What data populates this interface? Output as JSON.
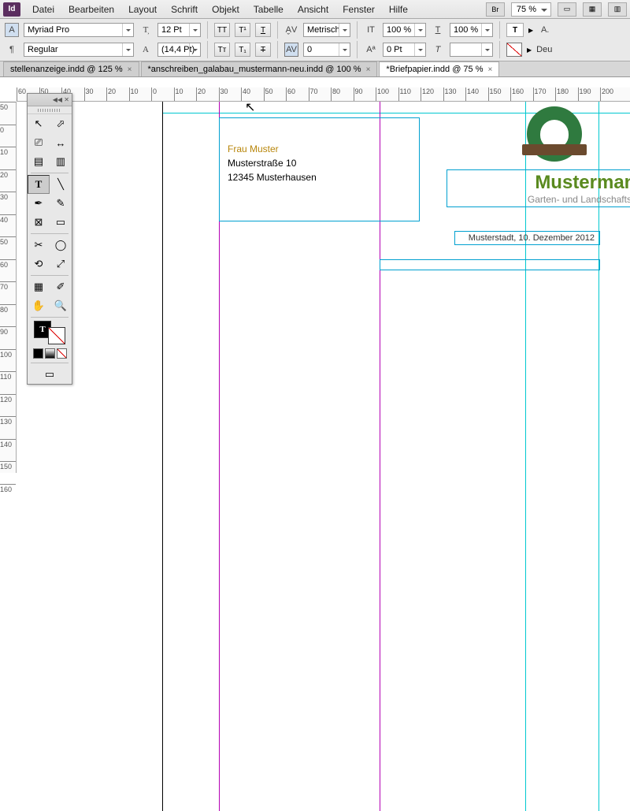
{
  "app": {
    "name": "Id"
  },
  "menu": [
    "Datei",
    "Bearbeiten",
    "Layout",
    "Schrift",
    "Objekt",
    "Tabelle",
    "Ansicht",
    "Fenster",
    "Hilfe"
  ],
  "zoom": "75 %",
  "br_label": "Br",
  "control": {
    "font": "Myriad Pro",
    "style": "Regular",
    "size": "12 Pt",
    "leading": "(14,4 Pt)",
    "kerning_mode": "Metrisch",
    "tracking": "0",
    "hscale": "100 %",
    "vscale": "100 %",
    "baseline": "0 Pt",
    "lang": "Deu"
  },
  "tabs": [
    {
      "label": "stellenanzeige.indd @ 125 %",
      "active": false
    },
    {
      "label": "*anschreiben_galabau_mustermann-neu.indd @ 100 %",
      "active": false
    },
    {
      "label": "*Briefpapier.indd @ 75 %",
      "active": true
    }
  ],
  "ruler_h": [
    "60",
    "50",
    "40",
    "30",
    "20",
    "10",
    "0",
    "10",
    "20",
    "30",
    "40",
    "50",
    "60",
    "70",
    "80",
    "90",
    "100",
    "110",
    "120",
    "130",
    "140",
    "150",
    "160",
    "170",
    "180",
    "190",
    "200"
  ],
  "ruler_v": [
    "50",
    "0",
    "10",
    "20",
    "30",
    "40",
    "50",
    "60",
    "70",
    "80",
    "90",
    "100",
    "110",
    "120",
    "130",
    "140",
    "150",
    "160"
  ],
  "doc": {
    "address": {
      "salutation": "Frau Muster",
      "street": "Musterstraße 10",
      "city": "12345 Musterhausen"
    },
    "company": {
      "name": "Mustermann",
      "sub": "Garten- und Landschaftsbau"
    },
    "date": "Musterstadt, 10. Dezember 2012"
  }
}
